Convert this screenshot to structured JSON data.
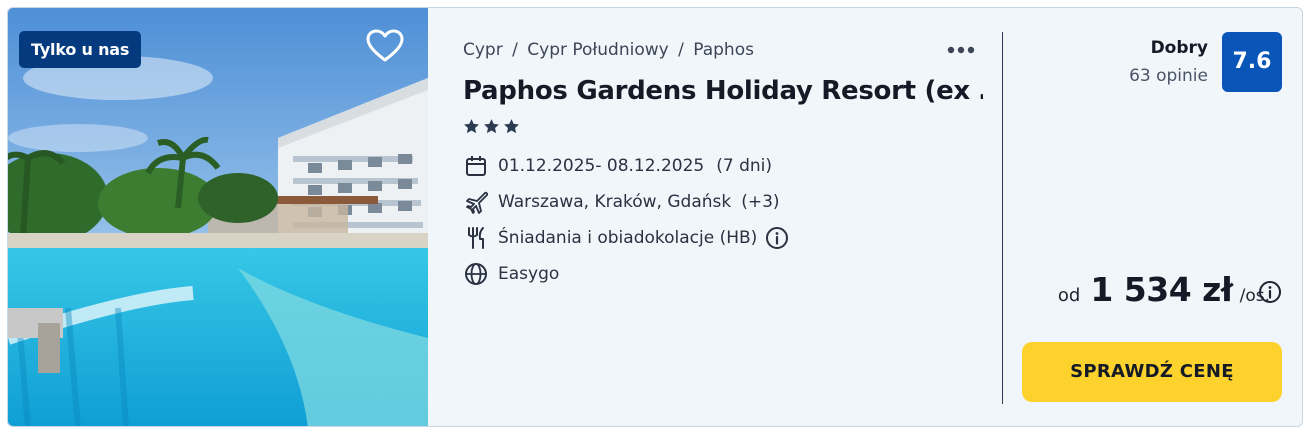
{
  "badge": {
    "label": "Tylko u nas"
  },
  "breadcrumb": [
    "Cypr",
    "Cypr Południowy",
    "Paphos"
  ],
  "hotel": {
    "name": "Paphos Gardens Holiday Resort (ex …",
    "stars": 3
  },
  "details": {
    "dates": "01.12.2025- 08.12.2025",
    "duration": "(7 dni)",
    "departure": "Warszawa, Kraków, Gdańsk",
    "departure_more": "(+3)",
    "board": "Śniadania i obiadokolacje (HB)",
    "operator": "Easygo"
  },
  "rating": {
    "label": "Dobry",
    "count": "63 opinie",
    "score": "7.6"
  },
  "price": {
    "from": "od",
    "amount": "1 534 zł",
    "per": "/os."
  },
  "cta": {
    "label": "SPRAWDŹ CENĘ"
  },
  "icons": {
    "favorite": "heart-outline-icon",
    "more": "more-horizontal-icon",
    "star": "star-icon",
    "calendar": "calendar-icon",
    "flight": "airplane-icon",
    "board": "cutlery-icon",
    "info": "info-icon",
    "operator": "globe-icon"
  },
  "colors": {
    "badge_bg": "#053a7f",
    "score_bg": "#0a55b8",
    "cta_bg": "#fdd22c",
    "card_bg": "#f1f6fb"
  }
}
